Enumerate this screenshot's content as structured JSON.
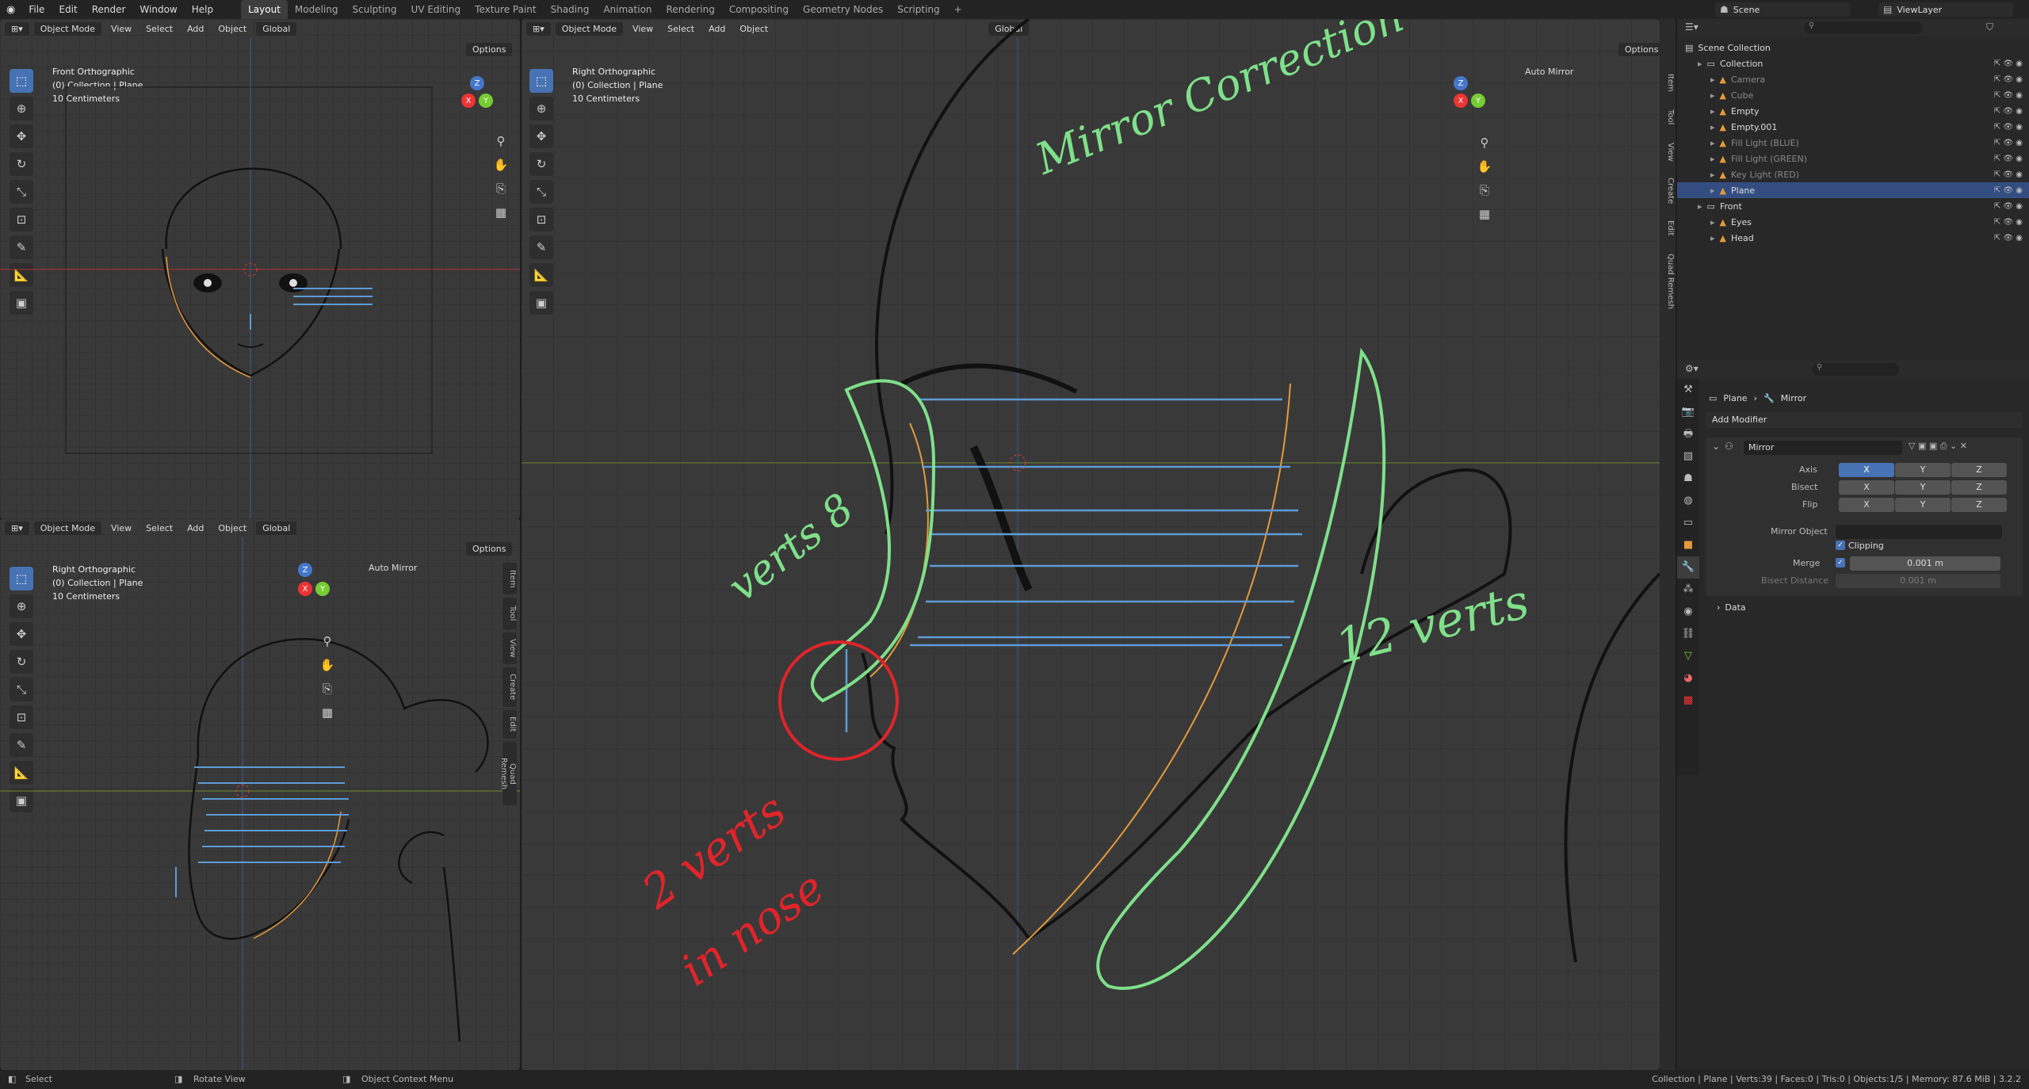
{
  "menus": [
    "File",
    "Edit",
    "Render",
    "Window",
    "Help"
  ],
  "workspaces": [
    "Layout",
    "Modeling",
    "Sculpting",
    "UV Editing",
    "Texture Paint",
    "Shading",
    "Animation",
    "Rendering",
    "Compositing",
    "Geometry Nodes",
    "Scripting"
  ],
  "scene": {
    "label": "Scene",
    "view_layer": "ViewLayer"
  },
  "vp_front": {
    "mode": "Object Mode",
    "menus": [
      "View",
      "Select",
      "Add",
      "Object"
    ],
    "orientation": "Global",
    "options": "Options",
    "title": "Front Orthographic",
    "info": "(0) Collection | Plane",
    "scale": "10 Centimeters"
  },
  "vp_side": {
    "mode": "Object Mode",
    "menus": [
      "View",
      "Select",
      "Add",
      "Object"
    ],
    "orientation": "Global",
    "options": "Options",
    "title": "Right Orthographic",
    "info": "(0) Collection | Plane",
    "scale": "10 Centimeters",
    "auto_mirror": "Auto Mirror",
    "tabs": [
      "Item",
      "Tool",
      "View",
      "Create",
      "Edit",
      "Quad Remesh"
    ]
  },
  "vp_main": {
    "mode": "Object Mode",
    "menus": [
      "View",
      "Select",
      "Add",
      "Object"
    ],
    "orientation": "Global",
    "options": "Options",
    "title": "Right Orthographic",
    "info": "(0) Collection | Plane",
    "scale": "10 Centimeters",
    "auto_mirror": "Auto Mirror",
    "tabs": [
      "Item",
      "Tool",
      "View",
      "Create",
      "Edit",
      "Quad Remesh"
    ]
  },
  "gizmo": {
    "x": "X",
    "y": "Y",
    "z": "Z"
  },
  "annotations": {
    "mirror": "Mirror Correction",
    "verts8": "verts 8",
    "verts12": "12 verts",
    "nose1": "2 verts",
    "nose2": "in nose"
  },
  "outliner": {
    "root": "Scene Collection",
    "rows": [
      {
        "name": "Collection",
        "level": 1,
        "kind": "collection"
      },
      {
        "name": "Camera",
        "level": 2,
        "kind": "obj",
        "dim": true
      },
      {
        "name": "Cube",
        "level": 2,
        "kind": "obj",
        "dim": true
      },
      {
        "name": "Empty",
        "level": 2,
        "kind": "obj"
      },
      {
        "name": "Empty.001",
        "level": 2,
        "kind": "obj"
      },
      {
        "name": "Fill Light (BLUE)",
        "level": 2,
        "kind": "obj",
        "dim": true
      },
      {
        "name": "Fill Light (GREEN)",
        "level": 2,
        "kind": "obj",
        "dim": true
      },
      {
        "name": "Key Light (RED)",
        "level": 2,
        "kind": "obj",
        "dim": true
      },
      {
        "name": "Plane",
        "level": 2,
        "kind": "obj",
        "sel": true
      },
      {
        "name": "Front",
        "level": 1,
        "kind": "collection"
      },
      {
        "name": "Eyes",
        "level": 2,
        "kind": "obj"
      },
      {
        "name": "Head",
        "level": 2,
        "kind": "obj"
      }
    ]
  },
  "properties": {
    "breadcrumb_obj": "Plane",
    "breadcrumb_mod": "Mirror",
    "add_modifier": "Add Modifier",
    "modifier_name": "Mirror",
    "axis_label": "Axis",
    "bisect_label": "Bisect",
    "flip_label": "Flip",
    "xyz": [
      "X",
      "Y",
      "Z"
    ],
    "mirror_object": "Mirror Object",
    "clipping": "Clipping",
    "merge": "Merge",
    "merge_value": "0.001 m",
    "bisect_distance": "Bisect Distance",
    "bisect_value": "0.001 m",
    "data": "Data"
  },
  "status": {
    "select": "Select",
    "rotate": "Rotate View",
    "context": "Object Context Menu",
    "info": "Collection | Plane | Verts:39 | Faces:0 | Tris:0 | Objects:1/5 | Memory: 87.6 MiB | 3.2.2"
  },
  "colors": {
    "accent": "#4772b3",
    "green": "#7fe08a",
    "red": "#e0242a",
    "blue_lines": "#5e9bd6",
    "orange": "#e59a3a"
  }
}
